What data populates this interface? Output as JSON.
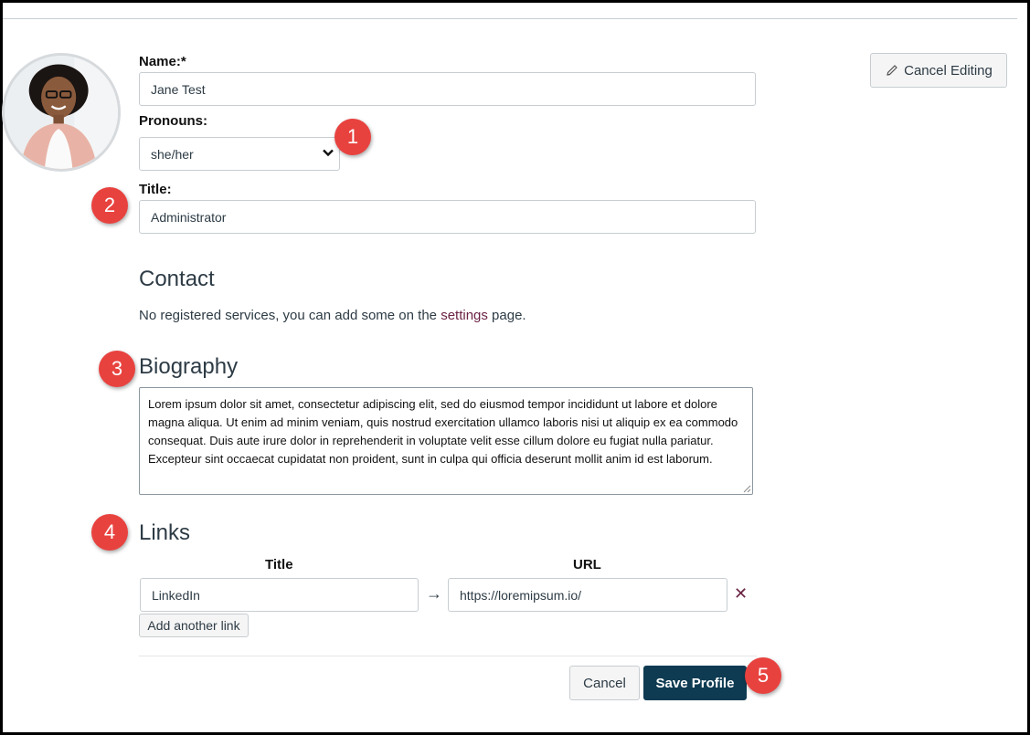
{
  "form": {
    "name_label": "Name:*",
    "name_value": "Jane Test",
    "pronouns_label": "Pronouns:",
    "pronouns_selected": "she/her",
    "title_label": "Title:",
    "title_value": "Administrator"
  },
  "header": {
    "cancel_editing_label": "Cancel Editing"
  },
  "contact": {
    "heading": "Contact",
    "text_before": "No registered services, you can add some on the ",
    "link_text": "settings",
    "text_after": " page."
  },
  "biography": {
    "heading": "Biography",
    "text": "Lorem ipsum dolor sit amet, consectetur adipiscing elit, sed do eiusmod tempor incididunt ut labore et dolore magna aliqua. Ut enim ad minim veniam, quis nostrud exercitation ullamco laboris nisi ut aliquip ex ea commodo consequat. Duis aute irure dolor in reprehenderit in voluptate velit esse cillum dolore eu fugiat nulla pariatur. Excepteur sint occaecat cupidatat non proident, sunt in culpa qui officia deserunt mollit anim id est laborum."
  },
  "links": {
    "heading": "Links",
    "col_title": "Title",
    "col_url": "URL",
    "rows": [
      {
        "title": "LinkedIn",
        "url": "https://loremipsum.io/"
      }
    ],
    "arrow": "→",
    "remove": "✕",
    "add_label": "Add another link"
  },
  "actions": {
    "cancel_label": "Cancel",
    "save_label": "Save Profile"
  },
  "callouts": [
    "1",
    "2",
    "3",
    "4",
    "5"
  ],
  "colors": {
    "accent": "#0e3b52",
    "callout": "#e8423f",
    "link": "#6b2344"
  }
}
